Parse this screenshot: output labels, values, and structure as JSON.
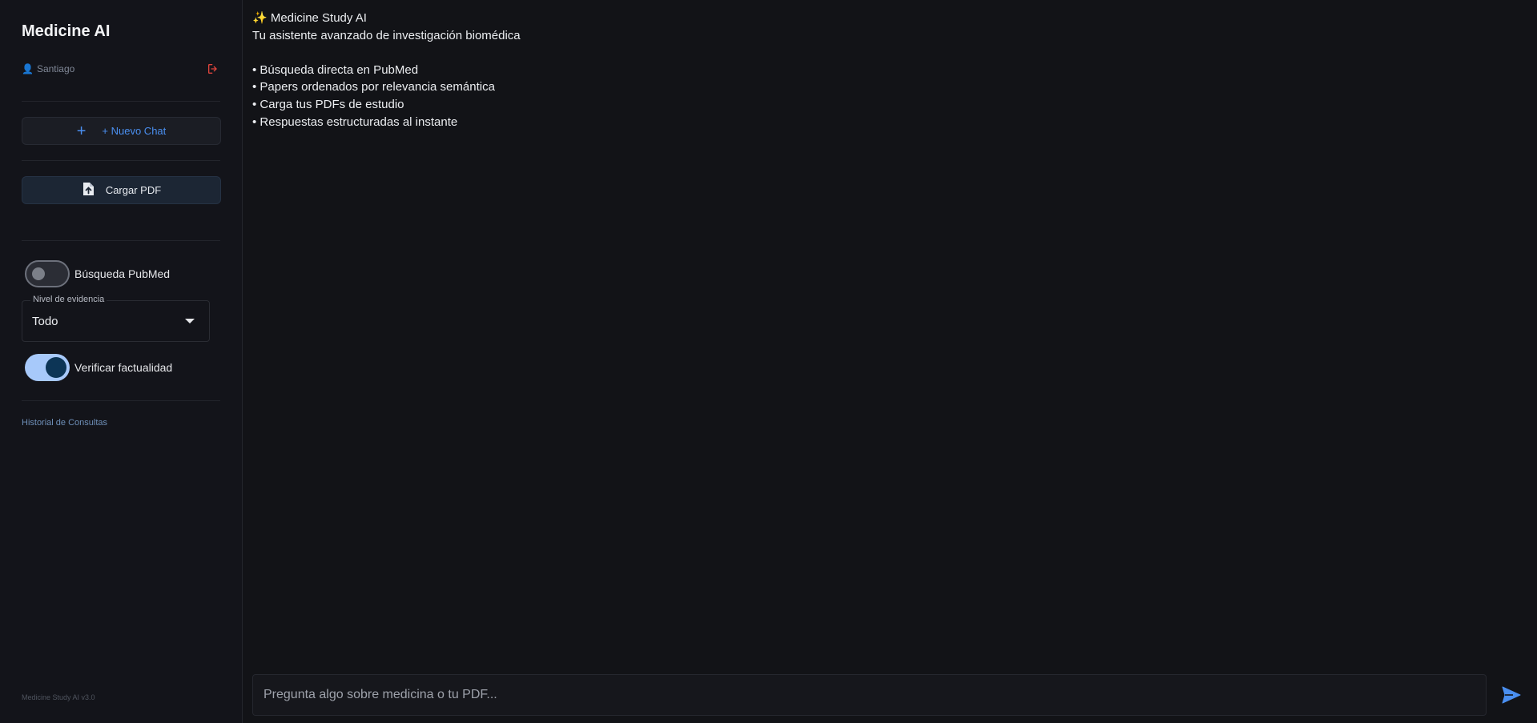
{
  "sidebar": {
    "brand": "Medicine AI",
    "user_name": "Santiago",
    "new_chat_label": "+ Nuevo Chat",
    "upload_pdf_label": "Cargar PDF",
    "pubmed_toggle": {
      "label": "Búsqueda PubMed",
      "on": false
    },
    "evidence_select": {
      "label": "Nivel de evidencia",
      "value": "Todo"
    },
    "fact_check_toggle": {
      "label": "Verificar factualidad",
      "on": true
    },
    "history_title": "Historial de Consultas",
    "version": "Medicine Study AI v3.0"
  },
  "welcome": {
    "title": "✨ Medicine Study AI",
    "subtitle": "Tu asistente avanzado de investigación biomédica",
    "features": [
      "• Búsqueda directa en PubMed",
      "• Papers ordenados por relevancia semántica",
      "• Carga tus PDFs de estudio",
      "• Respuestas estructuradas al instante"
    ]
  },
  "composer": {
    "placeholder": "Pregunta algo sobre medicina o tu PDF..."
  },
  "colors": {
    "accent": "#4a8ff0",
    "logout": "#e0453d",
    "toggle_on_track": "#a7c9fa",
    "toggle_on_knob": "#0c3556"
  },
  "icons": {
    "user": "user-icon",
    "logout": "logout-icon",
    "new_chat": "plus-icon",
    "upload": "file-upload-icon",
    "select": "chevron-down-icon",
    "send": "send-icon"
  }
}
